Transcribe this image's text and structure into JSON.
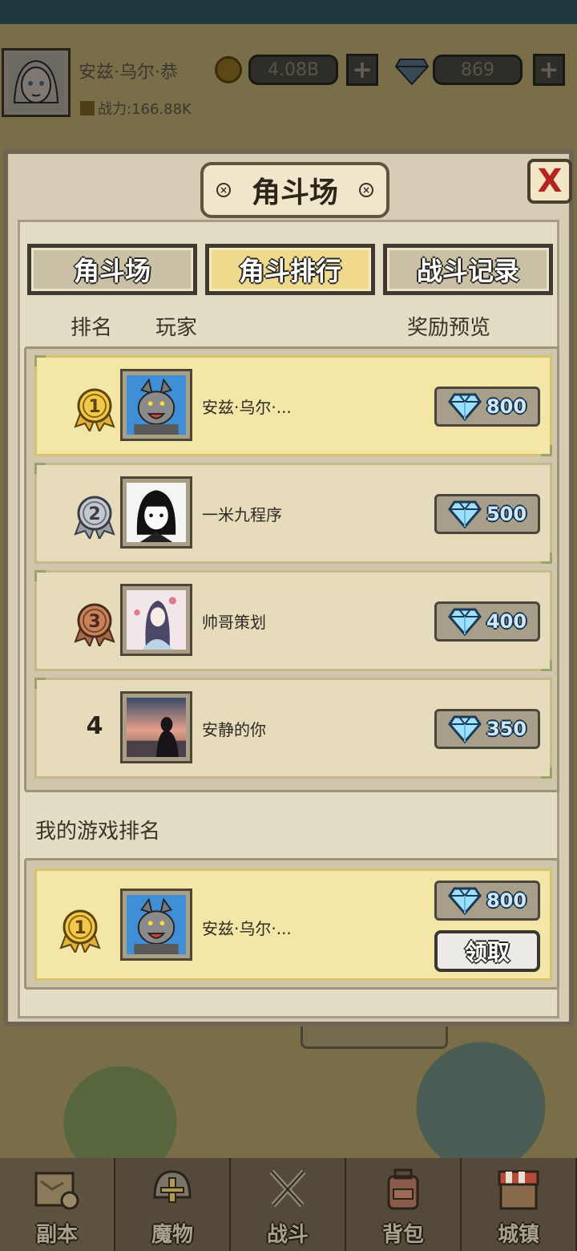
{
  "hud": {
    "player_name": "安兹·乌尔·恭",
    "gold": "4.08B",
    "gems": "869",
    "plus_label": "+",
    "power": "战力:166.88K"
  },
  "dialog": {
    "title": "角斗场",
    "close_label": "X",
    "tabs": [
      {
        "label": "角斗场",
        "active": false
      },
      {
        "label": "角斗排行",
        "active": true
      },
      {
        "label": "战斗记录",
        "active": false
      }
    ],
    "columns": {
      "rank": "排名",
      "player": "玩家",
      "reward": "奖励预览"
    },
    "rankings": [
      {
        "rank": "1",
        "name": "安兹·乌尔·...",
        "reward": "800",
        "medal": "gold"
      },
      {
        "rank": "2",
        "name": "一米九程序",
        "reward": "500",
        "medal": "silver"
      },
      {
        "rank": "3",
        "name": "帅哥策划",
        "reward": "400",
        "medal": "bronze"
      },
      {
        "rank": "4",
        "name": "安静的你",
        "reward": "350",
        "medal": "none"
      }
    ],
    "my_rank_title": "我的游戏排名",
    "my_rank": {
      "rank": "1",
      "name": "安兹·乌尔·...",
      "reward": "800",
      "claim_label": "领取"
    }
  },
  "nav": [
    {
      "label": "副本",
      "icon": "map-scroll-icon"
    },
    {
      "label": "魔物",
      "icon": "monster-helmet-icon"
    },
    {
      "label": "战斗",
      "icon": "crossed-swords-icon"
    },
    {
      "label": "背包",
      "icon": "backpack-icon"
    },
    {
      "label": "城镇",
      "icon": "town-shop-icon"
    }
  ],
  "colors": {
    "gold_row": "#f3e6a6",
    "normal_row": "#e6dcbc",
    "close_x": "#b3261e",
    "gem_text": "#cbe8ff"
  }
}
